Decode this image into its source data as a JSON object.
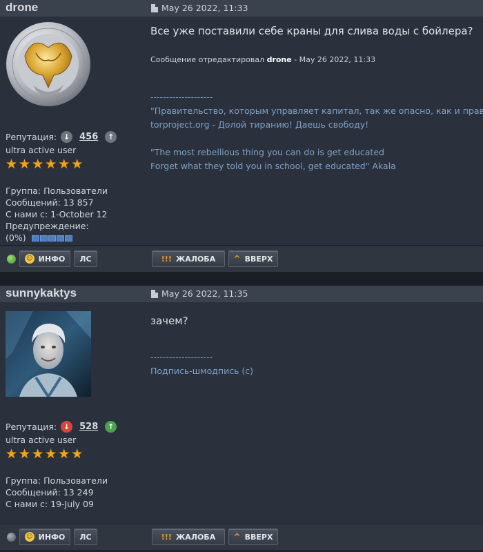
{
  "posts": [
    {
      "author": "drone",
      "date": "May 26 2022, 11:33",
      "message": "Все уже поставили себе краны для слива воды с бойлера?",
      "edited_prefix": "Сообщение отредактировал",
      "edited_by": "drone",
      "edited_suffix": "- May 26 2022, 11:33",
      "signature": [
        "--------------------",
        "\"Правительство, которым управляет капитал, так же опасно, как и правит",
        "torproject.org - Долой тиранию! Даешь свободу!",
        "",
        "\"The most rebellious thing you can do is get educated",
        "Forget what they told you in school, get educated\" Akala"
      ],
      "rep_label": "Репутация:",
      "rep_value": "456",
      "rank": "ultra active user",
      "stars": 6,
      "group": "Группа: Пользователи",
      "messages": "Сообщений: 13 857",
      "since": "С нами с: 1-October 12",
      "warning_label": "Предупреждение:",
      "warning_value": "(0%)",
      "online": true
    },
    {
      "author": "sunnykaktys",
      "date": "May 26 2022, 11:35",
      "message": "зачем?",
      "signature": [
        "--------------------",
        "Подпись-шмодпись (с)"
      ],
      "rep_label": "Репутация:",
      "rep_value": "528",
      "rank": "ultra active user",
      "stars": 6,
      "group": "Группа: Пользователи",
      "messages": "Сообщений: 13 249",
      "since": "С нами с: 19-July 09",
      "online": false
    }
  ],
  "buttons": {
    "info": "ИНФО",
    "pm": "ЛС",
    "report": "ЖАЛОБА",
    "top": "ВВЕРХ"
  },
  "icons": {
    "report": "!!!",
    "top": "^",
    "face": "☺",
    "rep_down": "↓",
    "rep_up": "↑",
    "star": "★"
  },
  "colors": {
    "online": "#5fb33a",
    "offline": "#6b7078",
    "rep_down_1": "#6f767f",
    "rep_down_2": "#d9453a",
    "rep_up": "#49a34a",
    "signature": "#7fa1c8"
  }
}
